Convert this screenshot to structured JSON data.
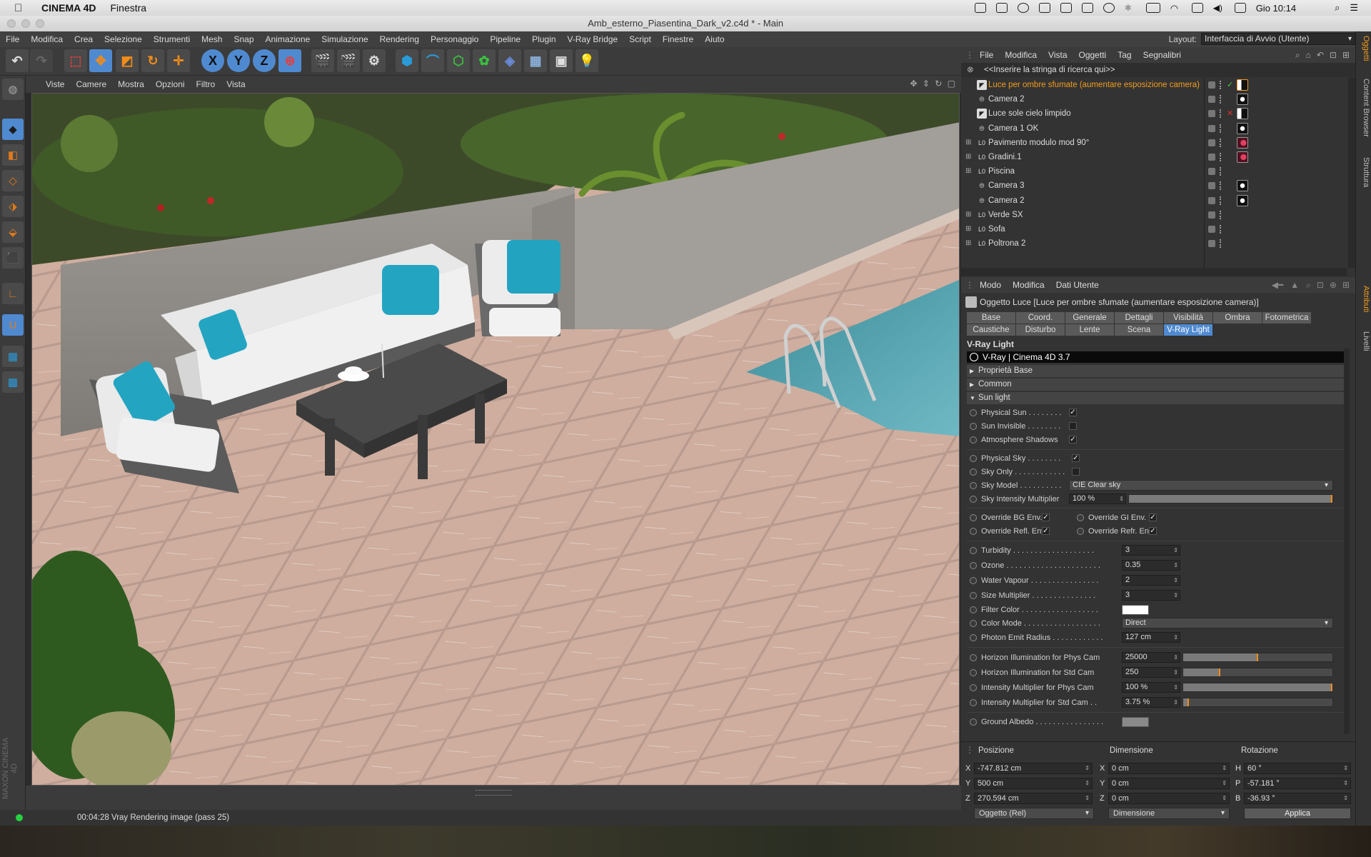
{
  "macbar": {
    "app": "CINEMA 4D",
    "menu": "Finestra",
    "clock": "Gio 10:14"
  },
  "window": {
    "title": "Amb_esterno_Piasentina_Dark_v2.c4d * - Main"
  },
  "menubar": {
    "items": [
      "File",
      "Modifica",
      "Crea",
      "Selezione",
      "Strumenti",
      "Mesh",
      "Snap",
      "Animazione",
      "Simulazione",
      "Rendering",
      "Personaggio",
      "Pipeline",
      "Plugin",
      "V-Ray Bridge",
      "Script",
      "Finestre",
      "Aiuto"
    ],
    "layout_label": "Layout:",
    "layout_value": "Interfaccia di Avvio (Utente)"
  },
  "toolbar": {
    "axis_x": "X",
    "axis_y": "Y",
    "axis_z": "Z"
  },
  "viewport_menu": [
    "Viste",
    "Camere",
    "Mostra",
    "Opzioni",
    "Filtro",
    "Vista"
  ],
  "brand": "MAXON CINEMA 4D",
  "status": {
    "text": "00:04:28 Vray Rendering image (pass 25)"
  },
  "objects": {
    "menu": [
      "File",
      "Modifica",
      "Vista",
      "Oggetti",
      "Tag",
      "Segnalibri"
    ],
    "search_placeholder": "<<Inserire la stringa di ricerca qui>>",
    "rows": [
      {
        "name": "Luce per ombre sfumate (aumentare esposizione camera)",
        "type": "light",
        "selected": true,
        "check": "✓",
        "tag": "light"
      },
      {
        "name": "Camera 2",
        "type": "camera",
        "selected": false,
        "check": "",
        "tag": "cam"
      },
      {
        "name": "Luce sole cielo limpido",
        "type": "light",
        "selected": false,
        "check": "✕",
        "tag": "light"
      },
      {
        "name": "Camera 1 OK",
        "type": "camera",
        "selected": false,
        "check": "",
        "tag": "cam"
      },
      {
        "name": "Pavimento modulo mod 90°",
        "type": "null",
        "selected": false,
        "check": "",
        "tag": "red"
      },
      {
        "name": "Gradini.1",
        "type": "null",
        "selected": false,
        "check": "",
        "tag": "red"
      },
      {
        "name": "Piscina",
        "type": "null",
        "selected": false,
        "check": "",
        "tag": ""
      },
      {
        "name": "Camera 3",
        "type": "camera",
        "selected": false,
        "check": "",
        "tag": "cam"
      },
      {
        "name": "Camera 2",
        "type": "camera",
        "selected": false,
        "check": "",
        "tag": "cam"
      },
      {
        "name": "Verde SX",
        "type": "null",
        "selected": false,
        "check": "",
        "tag": ""
      },
      {
        "name": "Sofa",
        "type": "null",
        "selected": false,
        "check": "",
        "tag": ""
      },
      {
        "name": "Poltrona 2",
        "type": "null",
        "selected": false,
        "check": "",
        "tag": ""
      }
    ]
  },
  "sidetabs": [
    "Oggetti",
    "Content Browser",
    "Struttura",
    "Attributi",
    "Livelli"
  ],
  "attributes": {
    "menu": [
      "Modo",
      "Modifica",
      "Dati Utente"
    ],
    "title": "Oggetto Luce [Luce per ombre sfumate (aumentare esposizione camera)]",
    "tabs_row1": [
      "Base",
      "Coord.",
      "Generale",
      "Dettagli",
      "Visibilità",
      "Ombra",
      "Fotometrica"
    ],
    "tabs_row2": [
      "Caustiche",
      "Disturbo",
      "Lente",
      "Scena",
      "V-Ray Light"
    ],
    "active_tab": "V-Ray Light",
    "section": "V-Ray Light",
    "version_bar": "V-Ray | Cinema 4D  3.7",
    "groups": [
      "Proprietà Base",
      "Common",
      "Sun light"
    ],
    "checks": {
      "physical_sun": {
        "label": "Physical Sun . . . . . . . .",
        "value": "✓"
      },
      "sun_invisible": {
        "label": "Sun Invisible . . . . . . . .",
        "value": ""
      },
      "atmosphere_shadows": {
        "label": "Atmosphere Shadows",
        "value": "✓"
      },
      "physical_sky": {
        "label": "Physical Sky . . . . . . . .",
        "value": "✓"
      },
      "sky_only": {
        "label": "Sky Only . . . . . . . . . . . .",
        "value": ""
      },
      "override_bg": {
        "label": "Override BG Env.",
        "value": "✓"
      },
      "override_gi": {
        "label": "Override GI Env. . .",
        "value": "✓"
      },
      "override_refl": {
        "label": "Override Refl. Env.",
        "value": "✓"
      },
      "override_refr": {
        "label": "Override Refr. Env.",
        "value": "✓"
      }
    },
    "sky_model": {
      "label": "Sky Model . . . . . . . . . .",
      "value": "CIE Clear sky"
    },
    "sky_intensity": {
      "label": "Sky Intensity Multiplier",
      "value": "100 %",
      "fraction": 1.0
    },
    "turbidity": {
      "label": "Turbidity . . . . . . . . . . . . . . . . . . .",
      "value": "3"
    },
    "ozone": {
      "label": "Ozone . . . . . . . . . . . . . . . . . . . . . .",
      "value": "0.35"
    },
    "water_vapour": {
      "label": "Water Vapour . . . . . . . . . . . . . . . .",
      "value": "2"
    },
    "size_multiplier": {
      "label": "Size Multiplier . . . . . . . . . . . . . . .",
      "value": "3"
    },
    "filter_color": {
      "label": "Filter Color . . . . . . . . . . . . . . . . . .",
      "value": "#ffffff"
    },
    "color_mode": {
      "label": "Color Mode . . . . . . . . . . . . . . . . . .",
      "value": "Direct"
    },
    "photon_radius": {
      "label": "Photon Emit Radius . . . . . . . . . . . .",
      "value": "127 cm"
    },
    "horizon_phys": {
      "label": "Horizon Illumination for Phys Cam",
      "value": "25000",
      "fraction": 0.5
    },
    "horizon_std": {
      "label": "Horizon Illumination for Std Cam",
      "value": "250",
      "fraction": 0.25
    },
    "intensity_phys": {
      "label": "Intensity Multiplier for Phys Cam",
      "value": "100 %",
      "fraction": 1.0
    },
    "intensity_std": {
      "label": "Intensity Multiplier for Std Cam . .",
      "value": "3.75 %",
      "fraction": 0.04
    },
    "ground_albedo": {
      "label": "Ground Albedo . . . . . . . . . . . . . . . .",
      "value": "#8a8a8a"
    }
  },
  "coords": {
    "headers": [
      "Posizione",
      "Dimensione",
      "Rotazione"
    ],
    "pos": {
      "x": "-747.812 cm",
      "y": "500 cm",
      "z": "270.594 cm"
    },
    "dim": {
      "x": "0 cm",
      "y": "0 cm",
      "z": "0 cm"
    },
    "rot": {
      "h": "60 °",
      "p": "-57.181 °",
      "b": "-36.93 °"
    },
    "axis": {
      "x": "X",
      "y": "Y",
      "z": "Z",
      "h": "H",
      "p": "P",
      "b": "B"
    },
    "mode1": "Oggetto (Rel)",
    "mode2": "Dimensione",
    "apply": "Applica"
  },
  "colors": {
    "accent_blue": "#4f8ad0",
    "accent_orange": "#f29c1e",
    "status_led": "#26d040"
  }
}
